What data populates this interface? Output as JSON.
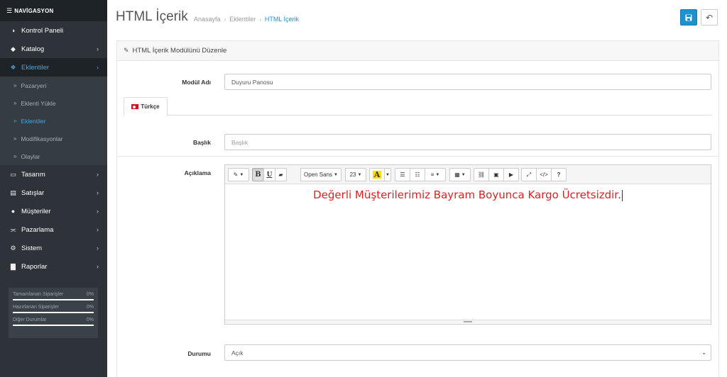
{
  "nav": {
    "heading": "NAVİGASYON",
    "items": [
      {
        "label": "Kontrol Paneli",
        "icon": "dashboard-icon",
        "glyph": "◑",
        "chevron": ""
      },
      {
        "label": "Katalog",
        "icon": "tag-icon",
        "glyph": "◆",
        "chevron": "›"
      },
      {
        "label": "Eklentiler",
        "icon": "puzzle-icon",
        "glyph": "❖",
        "chevron": "›"
      },
      {
        "label": "Tasarım",
        "icon": "monitor-icon",
        "glyph": "▭",
        "chevron": "›"
      },
      {
        "label": "Satışlar",
        "icon": "cart-icon",
        "glyph": "▤",
        "chevron": "›"
      },
      {
        "label": "Müşteriler",
        "icon": "user-icon",
        "glyph": "●",
        "chevron": "›"
      },
      {
        "label": "Pazarlama",
        "icon": "share-icon",
        "glyph": "⫘",
        "chevron": "›"
      },
      {
        "label": "Sistem",
        "icon": "gear-icon",
        "glyph": "⚙",
        "chevron": "›"
      },
      {
        "label": "Raporlar",
        "icon": "bar-chart-icon",
        "glyph": "▇",
        "chevron": "›"
      }
    ],
    "sub_items": [
      {
        "label": "Pazaryeri"
      },
      {
        "label": "Eklenti Yükle"
      },
      {
        "label": "Eklentiler"
      },
      {
        "label": "Modifikasyonlar"
      },
      {
        "label": "Olaylar"
      }
    ],
    "stats": [
      {
        "label": "Tamamlanan Siparişler",
        "value": "0%"
      },
      {
        "label": "Hazırlanan Siparişler",
        "value": "0%"
      },
      {
        "label": "Diğer Durumlar",
        "value": "0%"
      }
    ]
  },
  "header": {
    "title": "HTML İçerik",
    "breadcrumb": [
      "Anasayfa",
      "Eklentiler",
      "HTML İçerik"
    ],
    "save_glyph": "💾",
    "back_glyph": "↶"
  },
  "panel": {
    "title": "HTML İçerik Modülünü Düzenle"
  },
  "form": {
    "module_name_label": "Modül Adı",
    "module_name_value": "Duyuru Panosu",
    "tab_label": "Türkçe",
    "title_label": "Başlık",
    "title_placeholder": "Başlık",
    "desc_label": "Açıklama",
    "editor_text": "Değerli Müşterilerimiz Bayram Boyunca Kargo Ücretsizdir.",
    "status_label": "Durumu",
    "status_value": "Açık"
  },
  "toolbar": {
    "font_name": "Open Sans",
    "font_size": "23"
  },
  "colors": {
    "sidebar_bg": "#2d3338",
    "accent": "#1e91cf",
    "editor_text": "#e02020"
  }
}
